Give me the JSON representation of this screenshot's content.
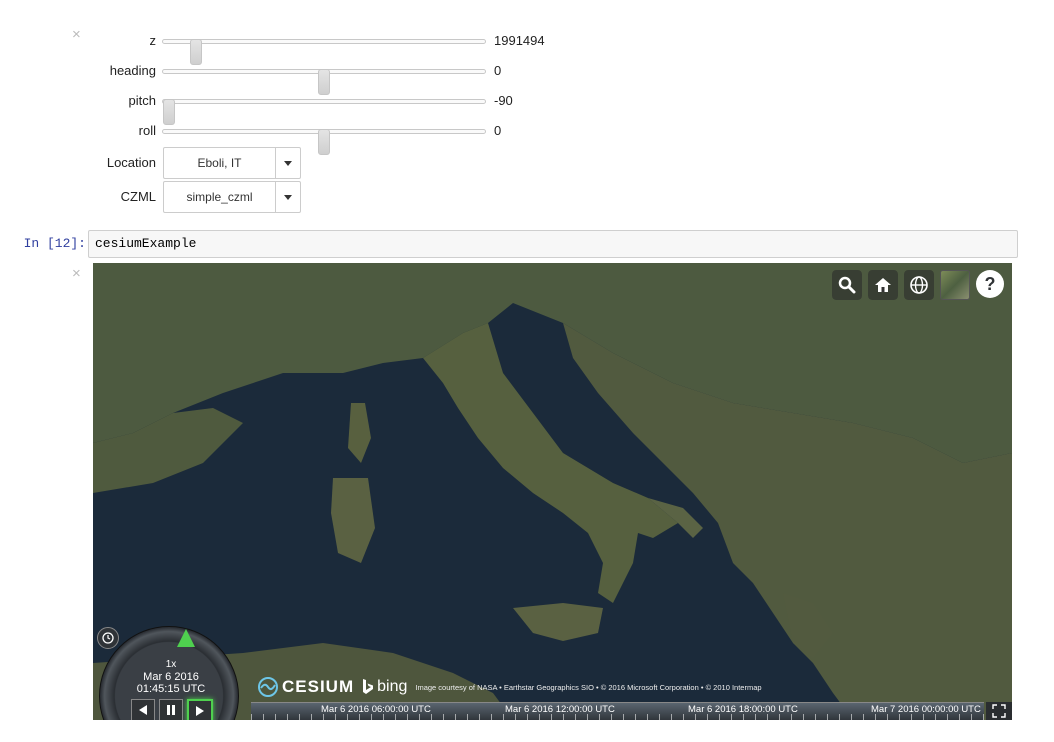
{
  "widgets": {
    "sliders": [
      {
        "label": "z",
        "value": "1991494",
        "level_fraction": 0.12
      },
      {
        "label": "heading",
        "value": "0",
        "level_fraction": 0.5
      },
      {
        "label": "pitch",
        "value": "-90",
        "level_fraction": 0.0
      },
      {
        "label": "roll",
        "value": "0",
        "level_fraction": 0.5
      }
    ],
    "dropdowns": [
      {
        "label": "Location",
        "value": "Eboli, IT"
      },
      {
        "label": "CZML",
        "value": "simple_czml"
      }
    ]
  },
  "cell": {
    "prompt": "In [12]:",
    "code": "cesiumExample"
  },
  "viewer": {
    "toolbar_icons": [
      "search-icon",
      "home-icon",
      "globe-icon",
      "imagery-layer-icon",
      "help-icon"
    ],
    "credits": {
      "cesium_text": "CESIUM",
      "bing_text": "bing",
      "attribution": "Image courtesy of NASA • Earthstar Geographics SIO • © 2016 Microsoft Corporation • © 2010 Intermap"
    },
    "animation": {
      "speed": "1x",
      "date": "Mar 6 2016",
      "time": "01:45:15 UTC",
      "play_state": "playing"
    },
    "timeline_labels": [
      "Mar 6 2016 06:00:00 UTC",
      "Mar 6 2016 12:00:00 UTC",
      "Mar 6 2016 18:00:00 UTC",
      "Mar 7 2016 00:00:00 UTC"
    ],
    "colors": {
      "sea": "#1b2a3a",
      "land": "#4a5a3c",
      "accent": "#4fd04f"
    }
  }
}
